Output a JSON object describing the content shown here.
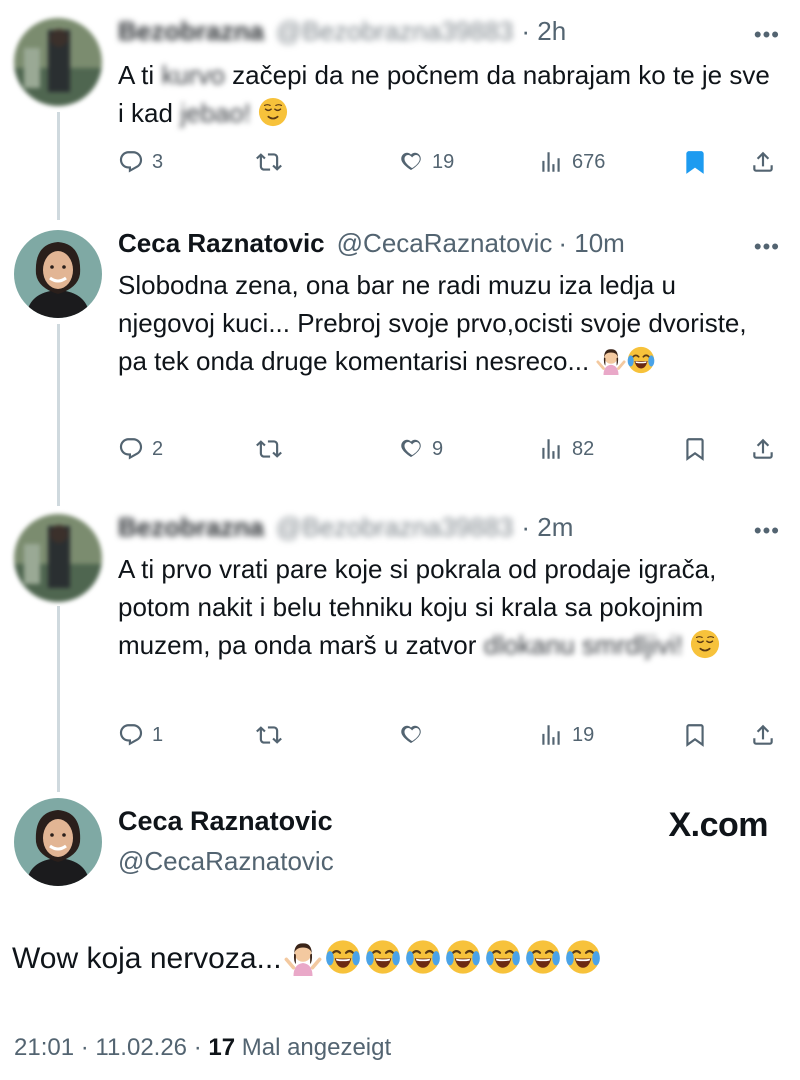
{
  "tweets": [
    {
      "name": "Bezobrazna",
      "handle": "@Bezobrazna39883",
      "time": "· 2h",
      "text_a": "A ti ",
      "text_censor1": "kurvo",
      "text_b": " začepi da ne počnem da nabrajam ko te je sve i kad ",
      "text_censor2": "jebao!",
      "emoji": "relieved-face",
      "replies": "3",
      "reposts": "",
      "likes": "19",
      "views": "676",
      "bookmarked": true
    },
    {
      "name": "Ceca Raznatovic",
      "handle": "@CecaRaznatovic",
      "time": "· 10m",
      "text": "Slobodna zena, ona bar ne radi muzu iza ledja u njegovoj kuci... Prebroj svoje prvo,ocisti svoje dvoriste, pa tek onda druge komentarisi nesreco...",
      "emojis": [
        "woman-shrugging",
        "face-with-tears-of-joy"
      ],
      "replies": "2",
      "reposts": "",
      "likes": "9",
      "views": "82",
      "bookmarked": false
    },
    {
      "name": "Bezobrazna",
      "handle": "@Bezobrazna39883",
      "time": "· 2m",
      "text": "A ti prvo vrati pare koje si pokrala od prodaje igrača, potom nakit i belu tehniku koju si krala sa pokojnim muzem, pa onda marš u zatvor ",
      "text_censor": "dlokanu smrdljivi!",
      "emoji": "relieved-face",
      "replies": "1",
      "reposts": "",
      "likes": "",
      "views": "19",
      "bookmarked": false
    }
  ],
  "main": {
    "name": "Ceca Raznatovic",
    "handle": "@CecaRaznatovic",
    "brand": "X.com",
    "text": "Wow koja nervoza...",
    "emojis": [
      "woman-shrugging",
      "face-with-tears-of-joy",
      "face-with-tears-of-joy",
      "face-with-tears-of-joy",
      "face-with-tears-of-joy",
      "face-with-tears-of-joy",
      "face-with-tears-of-joy",
      "face-with-tears-of-joy"
    ],
    "time": "21:01 · 11.02.26 · ",
    "views_count": "17",
    "views_label": " Mal angezeigt"
  },
  "icons": {
    "reply": "reply-icon",
    "repost": "repost-icon",
    "like": "like-icon",
    "views": "views-icon",
    "bookmark": "bookmark-icon",
    "share": "share-icon",
    "more": "more-icon"
  },
  "colors": {
    "text": "#0f1419",
    "muted": "#536471",
    "accent_blue": "#1d9bf0",
    "thread_line": "#cfd9de"
  }
}
